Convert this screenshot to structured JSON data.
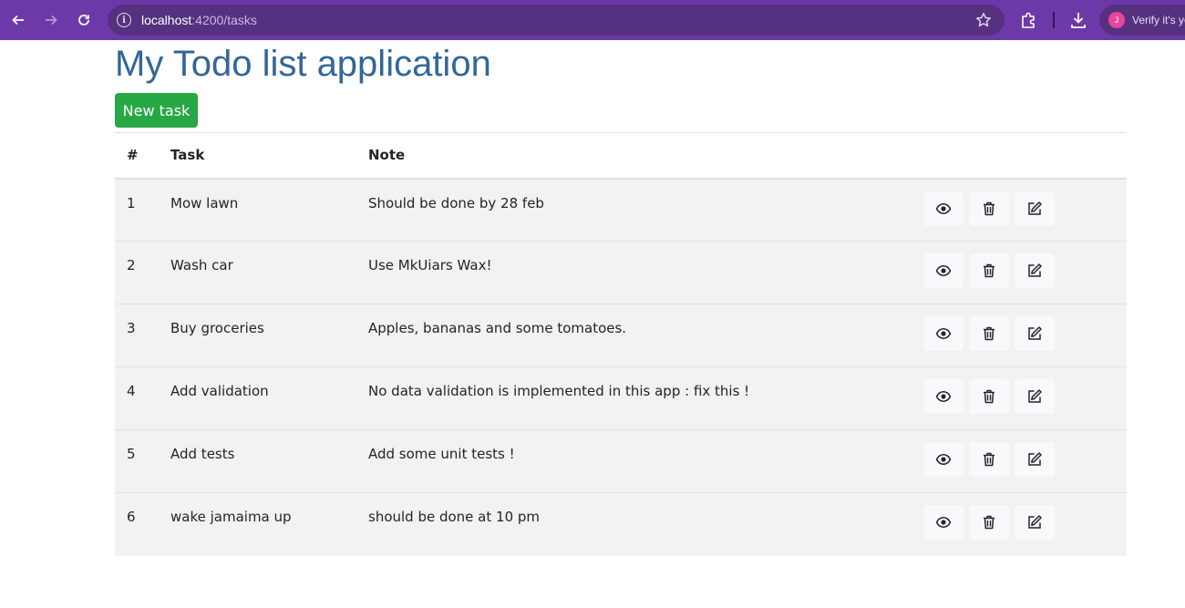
{
  "browser": {
    "url_host": "localhost",
    "url_path": ":4200/tasks",
    "profile_initial": "J",
    "profile_text": "Verify it's you"
  },
  "page": {
    "title": "My Todo list application",
    "new_task_label": "New task"
  },
  "table": {
    "headers": {
      "num": "#",
      "task": "Task",
      "note": "Note"
    },
    "rows": [
      {
        "num": "1",
        "task": "Mow lawn",
        "note": "Should be done by 28 feb"
      },
      {
        "num": "2",
        "task": "Wash car",
        "note": "Use MkUiars Wax!"
      },
      {
        "num": "3",
        "task": "Buy groceries",
        "note": "Apples, bananas and some tomatoes."
      },
      {
        "num": "4",
        "task": "Add validation",
        "note": "No data validation is implemented in this app : fix this !"
      },
      {
        "num": "5",
        "task": "Add tests",
        "note": "Add some unit tests !"
      },
      {
        "num": "6",
        "task": "wake jamaima up",
        "note": "should be done at 10 pm"
      }
    ],
    "actions": [
      "eye-icon",
      "trash-icon",
      "edit-icon"
    ]
  },
  "colors": {
    "browser_bar": "#6b3aa8",
    "title": "#336699",
    "new_task_button": "#28a745",
    "row_background": "#f2f2f2"
  }
}
